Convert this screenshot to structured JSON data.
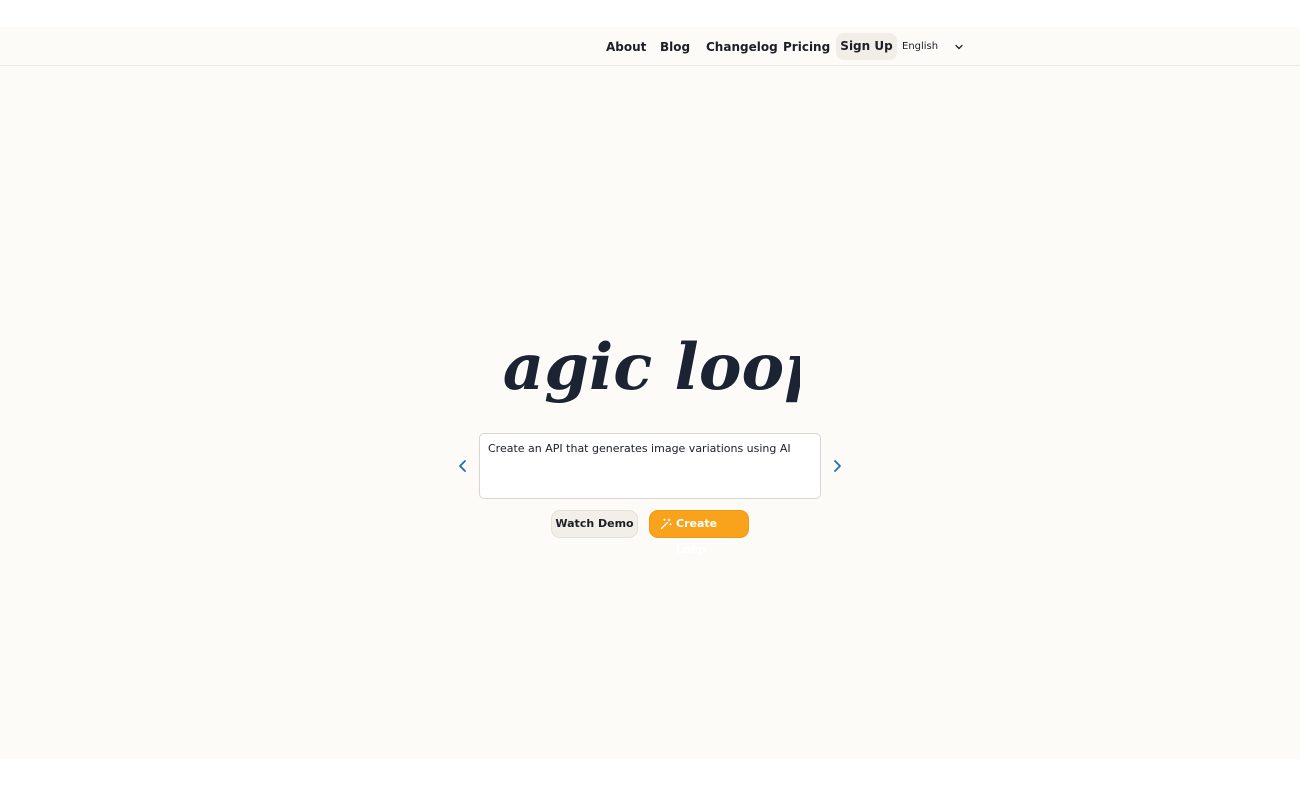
{
  "nav": {
    "links": [
      "About",
      "Blog",
      "Changelog",
      "Pricing"
    ],
    "signup_label": "Sign Up",
    "language": "English"
  },
  "hero": {
    "logo_text": "magic loops",
    "prompt_value": "Create an API that generates image variations using AI",
    "watch_label": "Watch Demo",
    "create_label": "Create Loop"
  },
  "icons": {
    "chevron_down": "chevron-down-icon",
    "prev": "chevron-left-icon",
    "next": "chevron-right-icon",
    "wand": "magic-wand-icon"
  },
  "colors": {
    "background": "#fcfbf8",
    "accent": "#f9a21b",
    "arrow": "#1e6fb8",
    "text": "#1c1f26"
  }
}
